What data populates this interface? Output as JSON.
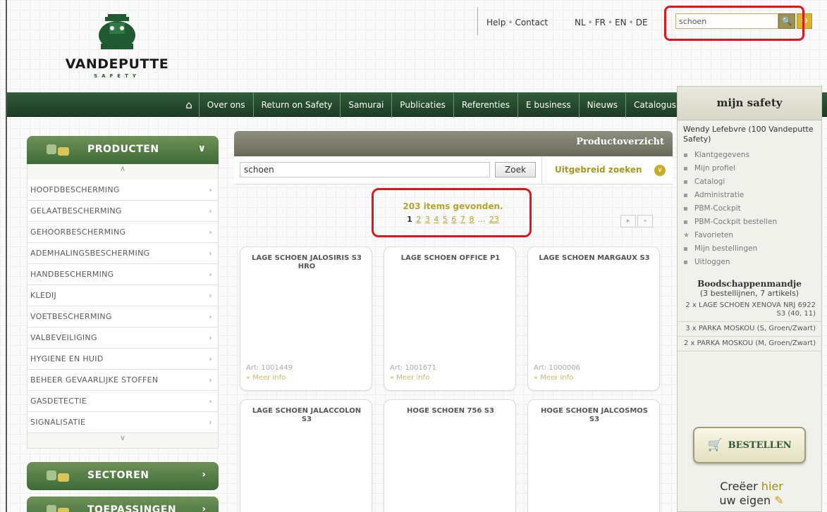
{
  "brand": {
    "name": "VANDEPUTTE",
    "sub": "SAFETY",
    "color": "#1f5a33"
  },
  "toplinks": {
    "help": "Help",
    "contact": "Contact",
    "sep": "•",
    "langs": [
      "NL",
      "FR",
      "EN",
      "DE"
    ]
  },
  "header_search": {
    "value": "schoen",
    "search_icon": "search-icon",
    "advanced_icon": "advanced-search-icon"
  },
  "nav": {
    "home_icon": "home-icon",
    "items": [
      "Over ons",
      "Return on Safety",
      "Samurai",
      "Publicaties",
      "Referenties",
      "E business",
      "Nieuws",
      "Catalogus"
    ]
  },
  "mijn": {
    "title": "mijn safety",
    "user": "Wendy Lefebvre (100 Vandeputte Safety)",
    "menu": [
      {
        "icon": "chart-icon",
        "label": "Klantgegevens"
      },
      {
        "icon": "profile-icon",
        "label": "Mijn profiel"
      },
      {
        "icon": "catalog-icon",
        "label": "Catalogi"
      },
      {
        "icon": "document-icon",
        "label": "Administratie"
      },
      {
        "icon": "cockpit-icon",
        "label": "PBM-Cockpit"
      },
      {
        "icon": "cockpit-order-icon",
        "label": "PBM-Cockpit bestellen"
      },
      {
        "icon": "star-icon",
        "label": "Favorieten"
      },
      {
        "icon": "orders-icon",
        "label": "Mijn bestellingen"
      },
      {
        "icon": "logout-icon",
        "label": "Uitloggen"
      }
    ],
    "cart_title": "Boodschappenmandje",
    "cart_sub": "(3 bestellijnen, 7 artikels)",
    "cart_lines": [
      "2 x LAGE SCHOEN XENOVA NRJ 6922 S3 (40, 11)",
      "3 x PARKA MOSKOU (S, Groen/Zwart)",
      "2 x PARKA MOSKOU (M, Groen/Zwart)"
    ],
    "order_label": "BESTELLEN",
    "create_prefix": "Creëer",
    "create_hl": "hier",
    "create_suffix": "uw eigen"
  },
  "left": {
    "producten": "PRODUCTEN",
    "sectoren": "SECTOREN",
    "toepassingen": "TOEPASSINGEN",
    "categories": [
      "HOOFDBESCHERMING",
      "GELAATBESCHERMING",
      "GEHOORBESCHERMING",
      "ADEMHALINGSBESCHERMING",
      "HANDBESCHERMING",
      "KLEDIJ",
      "VOETBESCHERMING",
      "VALBEVEILIGING",
      "HYGIENE EN HUID",
      "BEHEER GEVAARLIJKE STOFFEN",
      "GASDETECTIE",
      "SIGNALISATIE"
    ]
  },
  "overview": {
    "title": "Productoverzicht",
    "search_value": "schoen",
    "zoek": "Zoek",
    "advanced": "Uitgebreid zoeken",
    "found": "203 items gevonden.",
    "pages": [
      "1",
      "2",
      "3",
      "4",
      "5",
      "6",
      "7",
      "8",
      "...",
      "23"
    ],
    "products": [
      {
        "title": "LAGE SCHOEN JALOSIRIS S3 HRO",
        "art": "Art: 1001449",
        "more": "» Meer info"
      },
      {
        "title": "LAGE SCHOEN OFFICE P1",
        "art": "Art: 1001671",
        "more": "» Meer info"
      },
      {
        "title": "LAGE SCHOEN MARGAUX S3",
        "art": "Art: 1000006",
        "more": "» Meer info"
      },
      {
        "title": "LAGE SCHOEN JALACCOLON S3",
        "art": "",
        "more": ""
      },
      {
        "title": "HOGE SCHOEN 756 S3",
        "art": "",
        "more": ""
      },
      {
        "title": "HOGE SCHOEN JALCOSMOS S3",
        "art": "",
        "more": ""
      }
    ]
  },
  "colors": {
    "nav_green": "#2f5a39",
    "gold": "#b7a52c",
    "highlight_red": "#e0161e"
  }
}
